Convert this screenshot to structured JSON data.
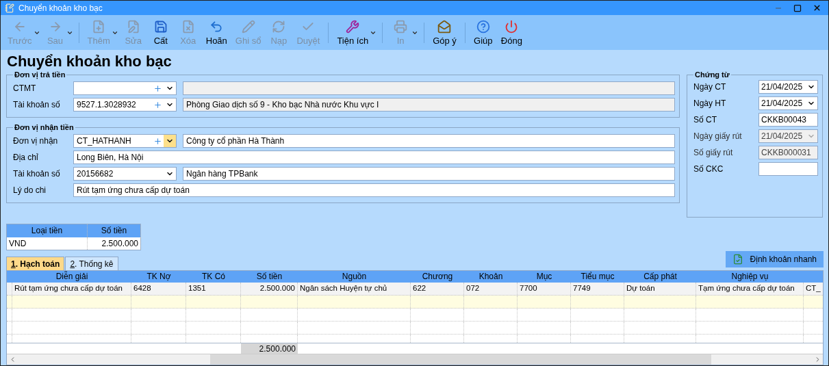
{
  "window": {
    "title": "Chuyển khoản kho bạc"
  },
  "toolbar": {
    "groups": [
      [
        {
          "kind": "back",
          "label": "Trước",
          "disabled": true,
          "dropdown": true
        },
        {
          "kind": "forward",
          "label": "Sau",
          "disabled": true,
          "dropdown": true
        }
      ],
      [
        {
          "kind": "add",
          "label": "Thêm",
          "disabled": true,
          "dropdown": true
        },
        {
          "kind": "edit",
          "label": "Sửa",
          "disabled": true,
          "dropdown": false
        },
        {
          "kind": "save",
          "label": "Cất",
          "disabled": false,
          "dropdown": false
        },
        {
          "kind": "delete",
          "label": "Xóa",
          "disabled": true,
          "dropdown": false
        },
        {
          "kind": "undo",
          "label": "Hoãn",
          "disabled": false,
          "dropdown": false
        },
        {
          "kind": "post",
          "label": "Ghi sổ",
          "disabled": true,
          "dropdown": false
        },
        {
          "kind": "reload",
          "label": "Nạp",
          "disabled": true,
          "dropdown": false
        },
        {
          "kind": "approve",
          "label": "Duyệt",
          "disabled": true,
          "dropdown": false
        }
      ],
      [
        {
          "kind": "tools",
          "label": "Tiện ích",
          "disabled": false,
          "dropdown": true
        }
      ],
      [
        {
          "kind": "print",
          "label": "In",
          "disabled": true,
          "dropdown": true
        }
      ],
      [
        {
          "kind": "feedback",
          "label": "Góp ý",
          "disabled": false,
          "dropdown": false
        }
      ],
      [
        {
          "kind": "help",
          "label": "Giúp",
          "disabled": false,
          "dropdown": false
        },
        {
          "kind": "close",
          "label": "Đóng",
          "disabled": false,
          "dropdown": false
        }
      ]
    ]
  },
  "page_title": "Chuyển khoản kho bạc",
  "payer": {
    "title": "Đơn vị trả tiền",
    "fields": [
      {
        "kind": "combo_add",
        "label": "CTMT",
        "focused": false,
        "description": {
          "disabled": true
        }
      },
      {
        "kind": "combo_add",
        "label": "Tài khoản số",
        "value": "9527.1.3028932",
        "focused": false,
        "description": {
          "text": "Phòng Giao dịch số 9 - Kho bạc Nhà nước Khu vực I",
          "disabled": true
        }
      }
    ]
  },
  "payee": {
    "title": "Đơn vị nhận tiền",
    "fields": [
      {
        "kind": "combo_add",
        "label": "Đơn vị nhận",
        "value": "CT_HATHANH",
        "focused": true,
        "description": {
          "text": "Công ty cổ phần Hà Thành",
          "disabled": false
        }
      },
      {
        "kind": "text",
        "label": "Địa chỉ",
        "value": "Long Biên, Hà Nội"
      },
      {
        "kind": "combo",
        "label": "Tài khoản số",
        "value": "20156682",
        "focused": false,
        "description": {
          "text": "Ngân hàng TPBank",
          "disabled": false
        }
      },
      {
        "kind": "text",
        "label": "Lý do chi",
        "value": "Rút tạm ứng chưa cấp dự toán"
      }
    ]
  },
  "voucher": {
    "title": "Chứng từ",
    "fields": [
      {
        "kind": "date",
        "label": "Ngày CT",
        "value": "21/04/2025",
        "disabled": false
      },
      {
        "kind": "date",
        "label": "Ngày HT",
        "value": "21/04/2025",
        "disabled": false
      },
      {
        "kind": "text",
        "label": "Số CT",
        "value": "CKKB00043",
        "disabled": false
      },
      {
        "kind": "date",
        "label": "Ngày giấy rút",
        "value": "21/04/2025",
        "disabled": true
      },
      {
        "kind": "text",
        "label": "Số giấy rút",
        "value": "CKKB000031",
        "disabled": true
      },
      {
        "kind": "text",
        "label": "Số CKC",
        "disabled": false
      }
    ]
  },
  "currency_table": {
    "columns": [
      "Loại tiền",
      "Số tiền"
    ],
    "rows": [
      [
        "VND",
        "2.500.000"
      ]
    ]
  },
  "tabs": [
    {
      "key": "1",
      "label": ". Hạch toán",
      "selected": true
    },
    {
      "key": "2",
      "label": ". Thống kê",
      "selected": false
    }
  ],
  "quick_button": "Định khoản nhanh",
  "grid": {
    "columns": [
      {
        "label": "Diễn giải",
        "kind": "text"
      },
      {
        "label": "TK Nợ",
        "kind": "text"
      },
      {
        "label": "TK Có",
        "kind": "text"
      },
      {
        "label": "Số tiền",
        "kind": "amount",
        "total": "2.500.000"
      },
      {
        "label": "Nguồn",
        "kind": "text"
      },
      {
        "label": "Chương",
        "kind": "text"
      },
      {
        "label": "Khoản",
        "kind": "text"
      },
      {
        "label": "Mục",
        "kind": "text"
      },
      {
        "label": "Tiểu mục",
        "kind": "text"
      },
      {
        "label": "Cấp phát",
        "kind": "text"
      },
      {
        "label": "Nghiệp vụ",
        "kind": "text"
      },
      {
        "kind": "text"
      }
    ],
    "rows": [
      {
        "kind": "data",
        "cells": [
          "Rút tạm ứng chưa cấp dự toán",
          "6428",
          "1351",
          "2.500.000",
          "Ngân sách Huyện tự chủ",
          "622",
          "072",
          "7700",
          "7749",
          "Dự toán",
          "Tạm ứng chưa cấp dự toán",
          "CT_"
        ]
      },
      {
        "kind": "new"
      },
      {
        "kind": "empty"
      },
      {
        "kind": "empty"
      },
      {
        "kind": "empty"
      }
    ]
  }
}
